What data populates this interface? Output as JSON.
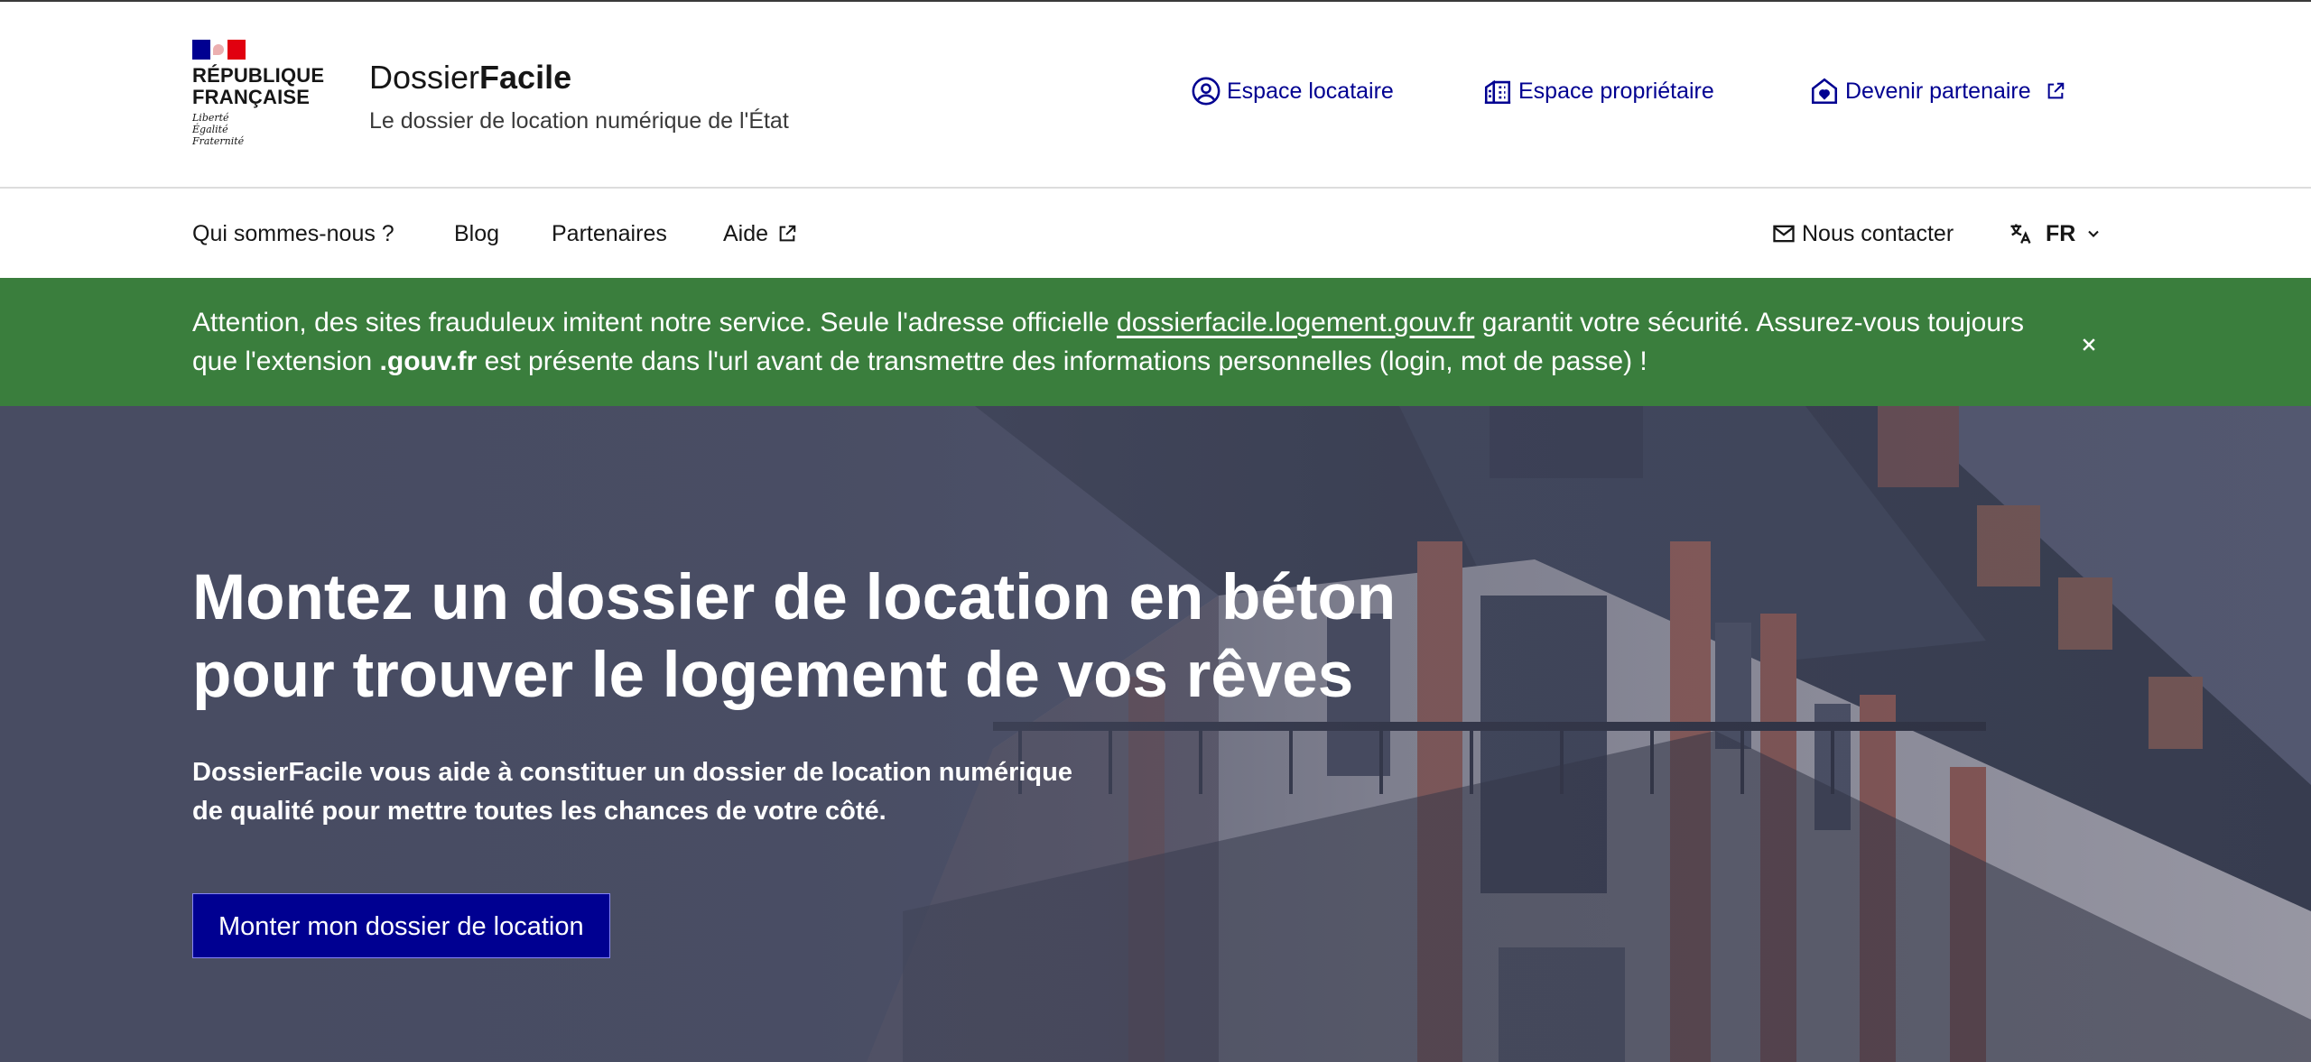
{
  "header": {
    "republic": [
      "RÉPUBLIQUE",
      "FRANÇAISE"
    ],
    "motto": [
      "Liberté",
      "Égalité",
      "Fraternité"
    ],
    "service_name_regular": "Dossier",
    "service_name_bold": "Facile",
    "tagline": "Le dossier de location numérique de l'État",
    "quick_links": [
      {
        "label": "Espace locataire",
        "icon": "user-circle-icon"
      },
      {
        "label": "Espace propriétaire",
        "icon": "building-icon"
      },
      {
        "label": "Devenir partenaire",
        "icon": "home-heart-icon"
      }
    ]
  },
  "nav": {
    "items": [
      "Qui sommes-nous ?",
      "Blog",
      "Partenaires",
      "Aide"
    ],
    "contact": "Nous contacter",
    "lang": "FR"
  },
  "notice": {
    "part1": "Attention, des sites frauduleux imitent notre service. Seule l'adresse officielle ",
    "link": "dossierfacile.logement.gouv.fr",
    "part2": " garantit votre sécurité. Assurez-vous toujours que l'extension ",
    "bold": ".gouv.fr",
    "part3": " est présente dans l'url avant de transmettre des informations personnelles (login, mot de passe) !",
    "bg_color": "#3a7e3d"
  },
  "hero": {
    "title_line1": "Montez un dossier de location en béton",
    "title_line2": "pour trouver le logement de vos rêves",
    "subtitle_line1": "DossierFacile vous aide à constituer un dossier de location numérique",
    "subtitle_line2": "de qualité pour mettre toutes les chances de votre côté.",
    "cta": "Monter mon dossier de location",
    "accent_color": "#000091"
  }
}
